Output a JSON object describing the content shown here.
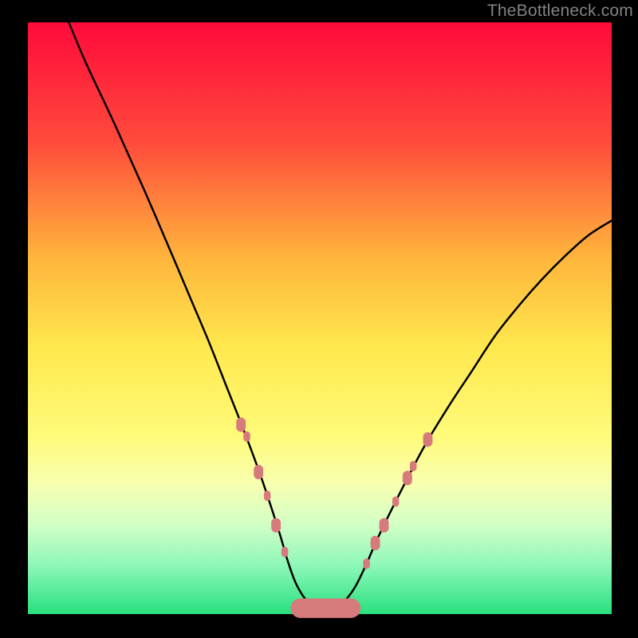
{
  "watermark": "TheBottleneck.com",
  "chart_data": {
    "type": "line",
    "title": "",
    "xlabel": "",
    "ylabel": "",
    "xlim": [
      0,
      100
    ],
    "ylim": [
      0,
      100
    ],
    "grid": false,
    "legend": false,
    "background": {
      "type": "vertical-gradient",
      "stops": [
        {
          "pos": 0,
          "color": "#ff0a3b"
        },
        {
          "pos": 20,
          "color": "#ff4a3b"
        },
        {
          "pos": 40,
          "color": "#ffb63c"
        },
        {
          "pos": 55,
          "color": "#ffe84e"
        },
        {
          "pos": 70,
          "color": "#fffb7a"
        },
        {
          "pos": 78,
          "color": "#f8ffb0"
        },
        {
          "pos": 85,
          "color": "#d2ffc6"
        },
        {
          "pos": 92,
          "color": "#8bf7b8"
        },
        {
          "pos": 100,
          "color": "#28e07e"
        }
      ]
    },
    "series": [
      {
        "name": "bottleneck-curve",
        "color": "#000000",
        "x": [
          7,
          10,
          15,
          20,
          25,
          28,
          31,
          34,
          37,
          40,
          43,
          44.5,
          46,
          48,
          50,
          52,
          54,
          56,
          58,
          60,
          64,
          68,
          72,
          76,
          80,
          84,
          88,
          92,
          96,
          100
        ],
        "y": [
          100,
          93,
          82.5,
          71.5,
          60,
          53,
          46,
          38.5,
          31,
          23,
          14,
          9,
          5,
          2,
          1,
          1,
          2,
          4.5,
          8.5,
          13,
          21,
          28.5,
          35,
          41,
          47,
          52,
          56.5,
          60.5,
          64,
          66.5
        ]
      }
    ],
    "markers": {
      "name": "highlight-dots",
      "color": "#d77a7c",
      "radius_primary": 7,
      "radius_secondary": 5,
      "points": [
        {
          "x": 36.5,
          "y": 32,
          "r": "primary"
        },
        {
          "x": 37.5,
          "y": 30,
          "r": "secondary"
        },
        {
          "x": 39.5,
          "y": 24,
          "r": "primary"
        },
        {
          "x": 41,
          "y": 20,
          "r": "secondary"
        },
        {
          "x": 42.5,
          "y": 15,
          "r": "primary"
        },
        {
          "x": 44,
          "y": 10.5,
          "r": "secondary"
        },
        {
          "x": 58,
          "y": 8.5,
          "r": "secondary"
        },
        {
          "x": 59.5,
          "y": 12,
          "r": "primary"
        },
        {
          "x": 61,
          "y": 15,
          "r": "primary"
        },
        {
          "x": 63,
          "y": 19,
          "r": "secondary"
        },
        {
          "x": 65,
          "y": 23,
          "r": "primary"
        },
        {
          "x": 66,
          "y": 25,
          "r": "secondary"
        },
        {
          "x": 68.5,
          "y": 29.5,
          "r": "primary"
        }
      ]
    },
    "floor_band": {
      "name": "bottom-pill",
      "color": "#d77a7c",
      "x_start": 45,
      "x_end": 57,
      "y": 1,
      "height": 3.3
    }
  }
}
